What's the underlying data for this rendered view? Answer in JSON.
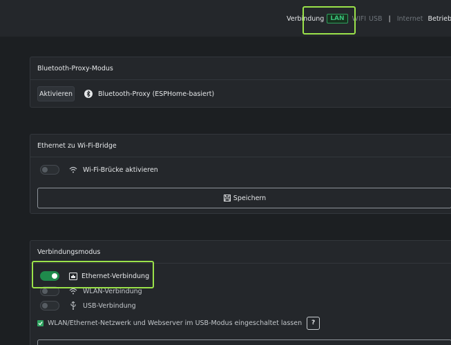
{
  "header": {
    "connection_label": "Verbindung",
    "active_badge": "LAN",
    "wifi_label": "WIFI",
    "usb_label": "USB",
    "separator": "|",
    "internet_label": "Internet",
    "uptime_label": "Betriebszeit"
  },
  "bluetooth": {
    "title": "Bluetooth-Proxy-Modus",
    "activate_label": "Aktivieren",
    "proxy_label": "Bluetooth-Proxy (ESPHome-basiert)"
  },
  "bridge": {
    "title": "Ethernet zu Wi-Fi-Bridge",
    "toggle_label": "Wi-Fi-Brücke aktivieren",
    "toggle_on": false,
    "save_label": "Speichern"
  },
  "mode": {
    "title": "Verbindungsmodus",
    "options": [
      {
        "label": "Ethernet-Verbindung",
        "on": true
      },
      {
        "label": "WLAN-Verbindung",
        "on": false
      },
      {
        "label": "USB-Verbindung",
        "on": false
      }
    ],
    "checkbox_label": "WLAN/Ethernet-Netzwerk und Webserver im USB-Modus eingeschaltet lassen",
    "checkbox_checked": true,
    "help_label": "?"
  },
  "colors": {
    "accent_green": "#2ea35f",
    "highlight": "#9be34a"
  }
}
